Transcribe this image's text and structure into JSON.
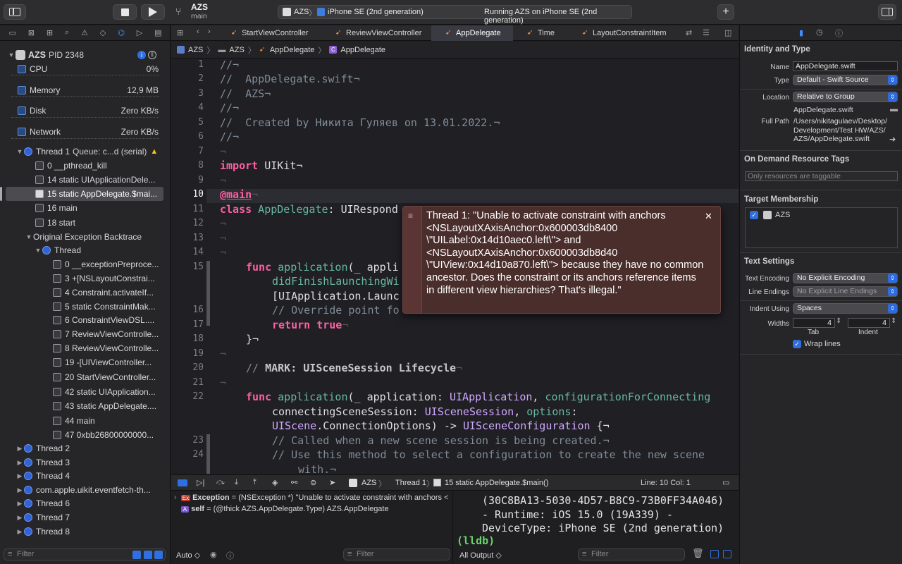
{
  "toolbar": {
    "project_name": "AZS",
    "branch": "main",
    "scheme_target": "AZS",
    "destination": "iPhone SE (2nd generation)",
    "status": "Running AZS on iPhone SE (2nd generation)"
  },
  "navigator": {
    "process": {
      "name": "AZS",
      "pid": "PID 2348"
    },
    "gauges": [
      {
        "label": "CPU",
        "value": "0%"
      },
      {
        "label": "Memory",
        "value": "12,9 MB"
      },
      {
        "label": "Disk",
        "value": "Zero KB/s"
      },
      {
        "label": "Network",
        "value": "Zero KB/s"
      }
    ],
    "thread1": {
      "label": "Thread 1",
      "queue": "Queue: c...d (serial)"
    },
    "thread1_frames": [
      "0 __pthread_kill",
      "14 static UIApplicationDele...",
      "15 static AppDelegate.$mai...",
      "16 main",
      "18 start"
    ],
    "backtrace_label": "Original Exception Backtrace",
    "backtrace_thread": "Thread",
    "backtrace_frames": [
      "0 __exceptionPreproce...",
      "3 +[NSLayoutConstrai...",
      "4 Constraint.activateIf...",
      "5 static ConstraintMak...",
      "6 ConstraintViewDSL....",
      "7 ReviewViewControlle...",
      "8 ReviewViewControlle...",
      "19 -[UIViewController...",
      "20 StartViewController...",
      "42 static UIApplication...",
      "43 static AppDelegate....",
      "44 main",
      "47 0xbb26800000000..."
    ],
    "other_threads": [
      "Thread 2",
      "Thread 3",
      "Thread 4",
      "com.apple.uikit.eventfetch-th...",
      "Thread 6",
      "Thread 7",
      "Thread 8"
    ],
    "filter_placeholder": "Filter"
  },
  "editor": {
    "tabs": [
      "StartViewController",
      "ReviewViewController",
      "AppDelegate",
      "Time",
      "LayoutConstraintItem"
    ],
    "jump_bar": [
      "AZS",
      "AZS",
      "AppDelegate",
      "AppDelegate"
    ],
    "line_numbers": [
      "1",
      "2",
      "3",
      "4",
      "5",
      "6",
      "7",
      "8",
      "9",
      "10",
      "11",
      "12",
      "13",
      "14",
      "15",
      "",
      "",
      "16",
      "17",
      "18",
      "19",
      "20",
      "21",
      "22",
      "",
      "",
      "23",
      "24"
    ],
    "code": {
      "l1": "//¬",
      "l2": "//  AppDelegate.swift¬",
      "l3": "//  AZS¬",
      "l4": "//¬",
      "l5": "//  Created by Никита Гуляев on 13.01.2022.¬",
      "l6": "//¬",
      "l7": "¬",
      "l8_kw": "import",
      "l8_rest": " UIKit¬",
      "l9": "¬",
      "l10": "@main",
      "l10_end": "¬",
      "l11_kw": "class",
      "l11_name": " AppDelegate",
      "l11_rest": ": UIRespond",
      "l12": "¬",
      "l13": "¬",
      "l14": "¬",
      "l15_kw": "func",
      "l15_fn": " application",
      "l15_rest": "(_ appli",
      "l15b": "didFinishLaunchingWi",
      "l15c": "[UIApplication.Launc",
      "l16": "// Override point fo",
      "l17_kw": "return",
      "l17_val": " true",
      "l17_end": "¬",
      "l18": "}¬",
      "l19": "¬",
      "l20_c": "// ",
      "l20_mark": "MARK: UISceneSession Lifecycle",
      "l20_end": "¬",
      "l21": "¬",
      "l22_kw": "func",
      "l22_fn": " application",
      "l22_a": "(_ application: ",
      "l22_t": "UIApplication",
      "l22_b": ", ",
      "l22_p": "configurationForConnecting",
      "l22b_a": "connectingSceneSession: ",
      "l22b_t": "UISceneSession",
      "l22b_b": ", ",
      "l22b_p": "options",
      "l22b_c": ":",
      "l22c_t": "UIScene",
      "l22c_a": ".ConnectionOptions) -> ",
      "l22c_t2": "UISceneConfiguration",
      "l22c_b": " {¬",
      "l23": "// Called when a new scene session is being created.¬",
      "l24": "// Use this method to select a configuration to create the new scene",
      "l24b": "with.¬"
    },
    "error_message": "Thread 1: \"Unable to activate constraint with anchors <NSLayoutXAxisAnchor:0x600003db8400 \\\"UILabel:0x14d10aec0.left\\\"> and <NSLayoutXAxisAnchor:0x600003db8d40 \\\"UIView:0x14d10a870.left\\\"> because they have no common ancestor.  Does the constraint or its anchors reference items in different view hierarchies?  That's illegal.\""
  },
  "debug_bar": {
    "path": [
      "AZS",
      "Thread 1",
      "15 static AppDelegate.$main()"
    ],
    "position": "Line: 10  Col: 1"
  },
  "variables": [
    {
      "badge": "Ex",
      "name": "Exception",
      "value": " = (NSException *) \"Unable to activate constraint with anchors <NSL..."
    },
    {
      "badge": "A",
      "name": "self",
      "value": " = (@thick AZS.AppDelegate.Type) AZS.AppDelegate"
    }
  ],
  "variables_scope": "Auto ◇",
  "variables_filter": "Filter",
  "console": {
    "lines": [
      "(30C8BA13-5030-4D57-B8C9-73B0FF34A046)",
      "- Runtime: iOS 15.0 (19A339) -",
      "DeviceType: iPhone SE (2nd generation)"
    ],
    "prompt": "(lldb)",
    "output_selector": "All Output ◇",
    "filter": "Filter"
  },
  "inspector": {
    "identity_title": "Identity and Type",
    "name_label": "Name",
    "name_value": "AppDelegate.swift",
    "type_label": "Type",
    "type_value": "Default - Swift Source",
    "location_label": "Location",
    "location_value": "Relative to Group",
    "location_file": "AppDelegate.swift",
    "fullpath_label": "Full Path",
    "fullpath_value_1": "/Users/nikitagulaev/Desktop/",
    "fullpath_value_2": "Development/Test HW/AZS/",
    "fullpath_value_3": "AZS/AppDelegate.swift",
    "odr_title": "On Demand Resource Tags",
    "odr_placeholder": "Only resources are taggable",
    "target_title": "Target Membership",
    "target_name": "AZS",
    "text_title": "Text Settings",
    "encoding_label": "Text Encoding",
    "encoding_value": "No Explicit Encoding",
    "endings_label": "Line Endings",
    "endings_value": "No Explicit Line Endings",
    "indent_label": "Indent Using",
    "indent_value": "Spaces",
    "widths_label": "Widths",
    "tab_value": "4",
    "indent_width_value": "4",
    "tab_caption": "Tab",
    "indent_caption": "Indent",
    "wrap_label": "Wrap lines"
  }
}
